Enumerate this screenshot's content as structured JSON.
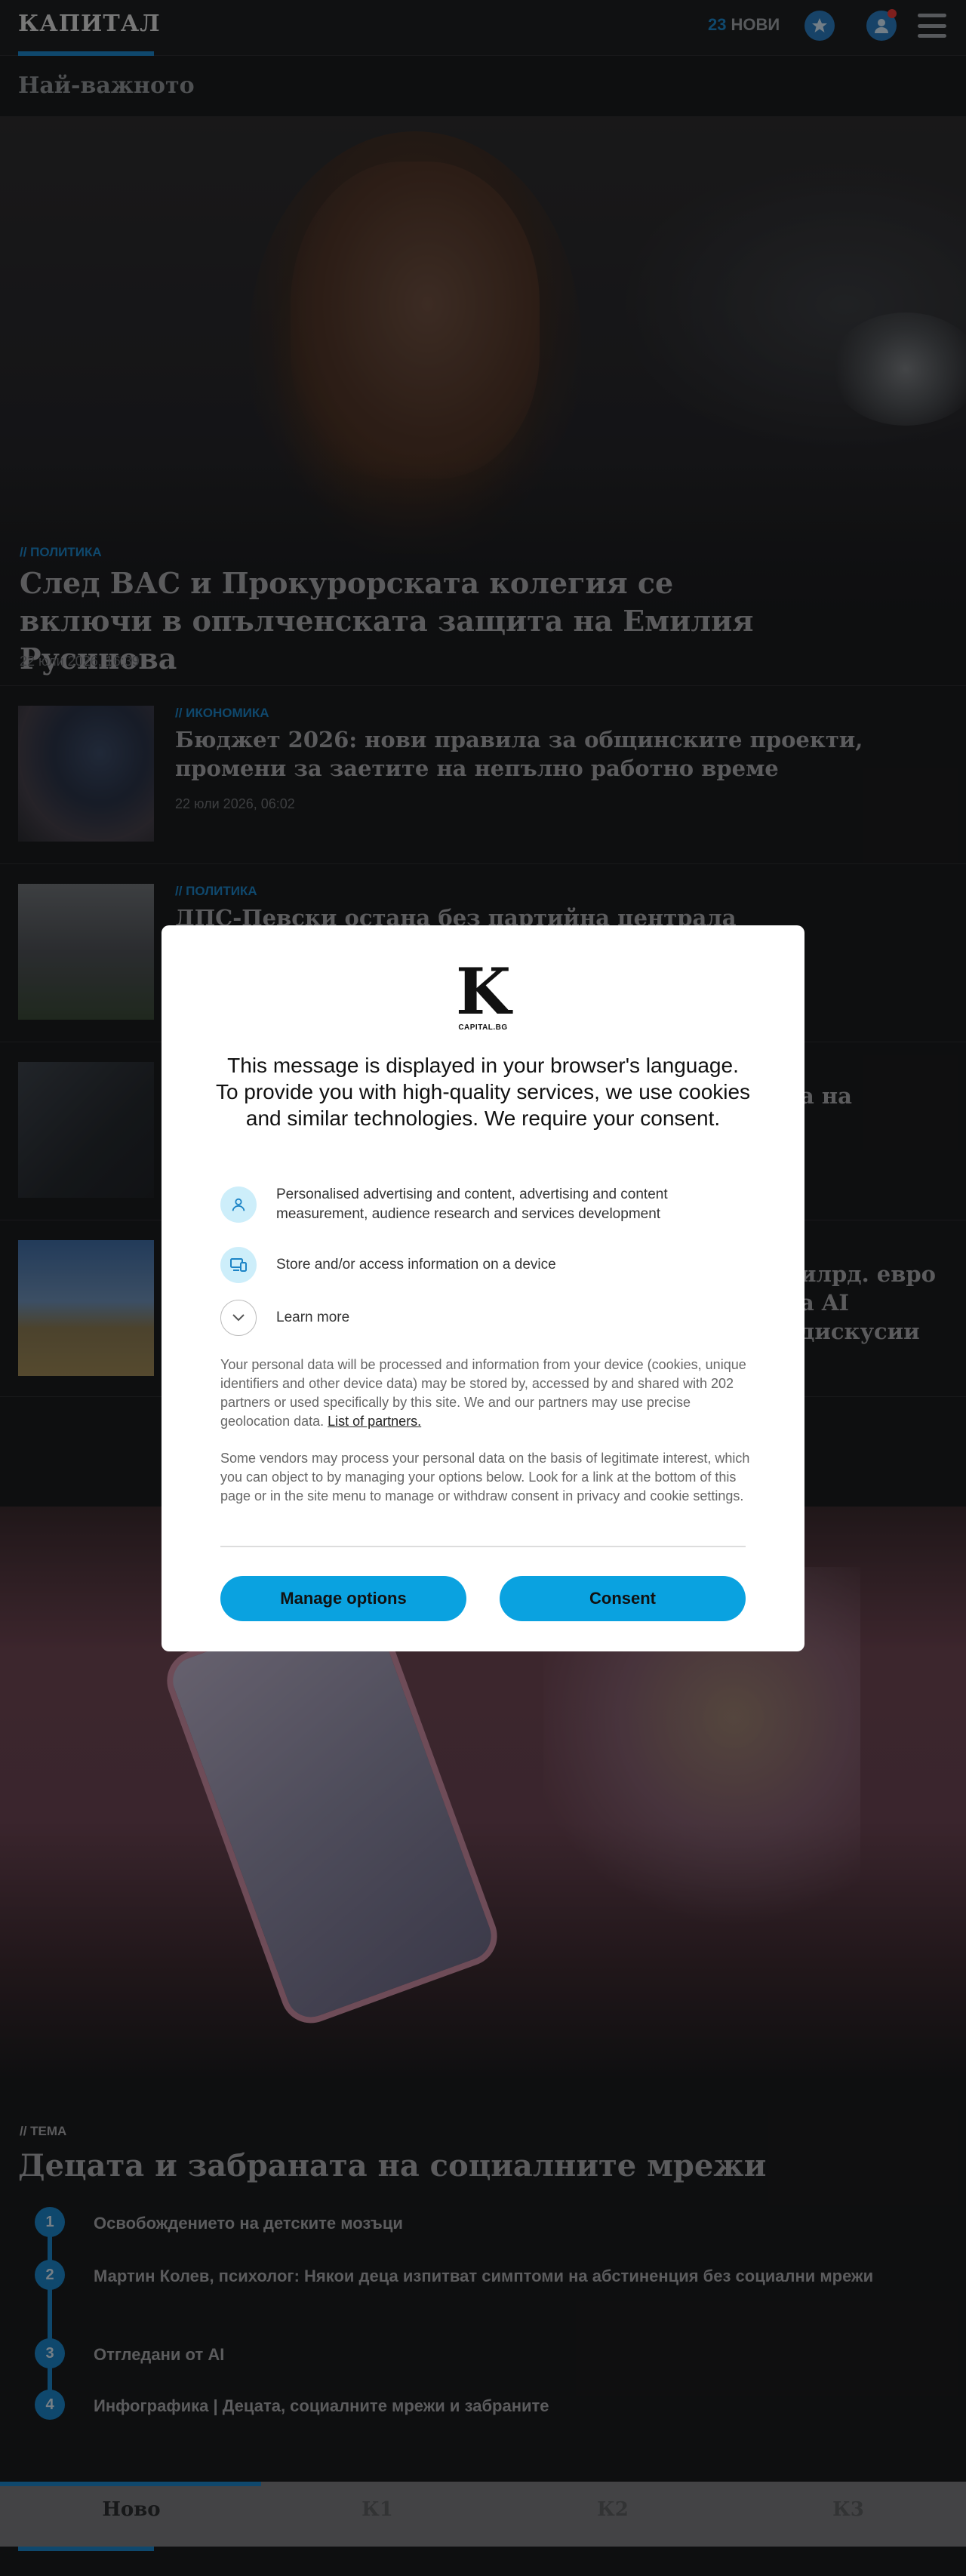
{
  "header": {
    "logo": "КАПИТАЛ",
    "news_count": "23",
    "news_label": "НОВИ"
  },
  "section_title": "Най-важното",
  "hero": {
    "category": "// ПОЛИТИКА",
    "title": "След ВАС и Прокурорската колегия се включи в опълченската защита на Емилия Русинова",
    "date": "22 юли 2026, 16:39"
  },
  "articles": [
    {
      "category": "// ИКОНОМИКА",
      "title": "Бюджет 2026: нови правила за общинските проекти, промени за заетите на непълно работно време",
      "date": "22 юли 2026, 06:02"
    },
    {
      "category": "// ПОЛИТИКА",
      "title": "ДПС-Певски остана без партийна централа"
    },
    {
      "title_tail": "а на"
    },
    {
      "title_tail_1": "илрд. евро",
      "title_tail_2": "а AI дискусии"
    }
  ],
  "theme": {
    "kicker": "// ТЕМА",
    "title": "Децата и забраната на социалните мрежи",
    "items": [
      {
        "num": "1",
        "text": "Освобождението на детските мозъци"
      },
      {
        "num": "2",
        "text": "Мартин Колев, психолог: Някои деца изпитват симптоми на абстиненция без социални мрежи"
      },
      {
        "num": "3",
        "text": "Отгледани от AI"
      },
      {
        "num": "4",
        "text": "Инфографика | Децата, социалните мрежи и забраните"
      }
    ]
  },
  "tabs": [
    {
      "label": "Ново",
      "active": true
    },
    {
      "label": "К1"
    },
    {
      "label": "К2"
    },
    {
      "label": "К3"
    }
  ],
  "consent": {
    "logo_letter": "K",
    "logo_sub": "CAPITAL.BG",
    "heading": "This message is displayed in your browser's language. To provide you with high-quality services, we use cookies and similar technologies. We require your consent.",
    "purpose_1": "Personalised advertising and content, advertising and content measurement, audience research and services development",
    "purpose_2": "Store and/or access information on a device",
    "learn_more": "Learn more",
    "paragraph_1": "Your personal data will be processed and information from your device (cookies, unique identifiers and other device data) may be stored by, accessed by and shared with 202 partners or used specifically by this site. We and our partners may use precise geolocation data.",
    "partners_link": "List of partners.",
    "paragraph_2": "Some vendors may process your personal data on the basis of legitimate interest, which you can object to by managing your options below. Look for a link at the bottom of this page or in the site menu to manage or withdraw consent in privacy and cookie settings.",
    "manage_label": "Manage options",
    "consent_label": "Consent"
  },
  "colors": {
    "accent": "#1c84c6",
    "consent_button": "#0aa2e0",
    "background": "#1b1c1e"
  },
  "icons": [
    "star-icon",
    "user-icon",
    "hamburger-menu-icon",
    "person-icon",
    "device-icon",
    "chevron-down-icon"
  ]
}
